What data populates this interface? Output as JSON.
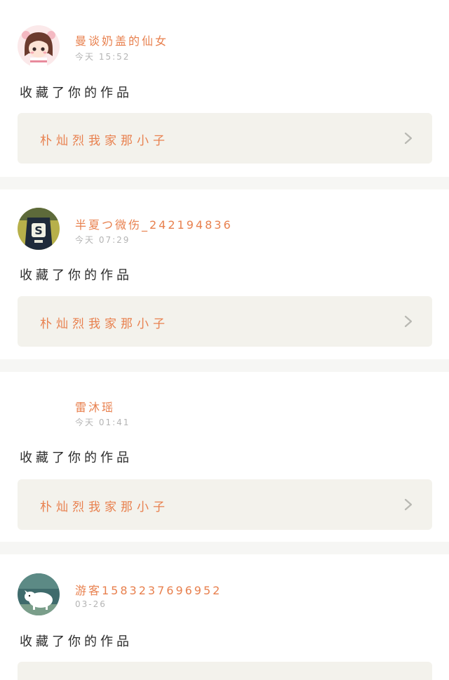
{
  "notifications": [
    {
      "username": "曼谈奶盖的仙女",
      "time": "今天 15:52",
      "action": "收藏了你的作品",
      "work_title": "朴灿烈我家那小子",
      "avatar_icon": "cartoon-girl-avatar"
    },
    {
      "username": "半夏つ微伤_242194836",
      "time": "今天 07:29",
      "action": "收藏了你的作品",
      "work_title": "朴灿烈我家那小子",
      "avatar_icon": "jersey-photo-avatar"
    },
    {
      "username": "雷沐瑶",
      "time": "今天 01:41",
      "action": "收藏了你的作品",
      "work_title": "朴灿烈我家那小子",
      "avatar_icon": "blank-avatar"
    },
    {
      "username": "游客1583237696952",
      "time": "03-26",
      "action": "收藏了你的作品",
      "work_title": "",
      "avatar_icon": "cartoon-dog-avatar"
    }
  ],
  "colors": {
    "accent": "#e8804e",
    "background": "#f6f6f4",
    "card": "#ffffff",
    "work_box": "#f3f2ec",
    "time_text": "#b4b4b4",
    "body_text": "#2b2b2b",
    "top_indicator": "#e07aa0"
  }
}
